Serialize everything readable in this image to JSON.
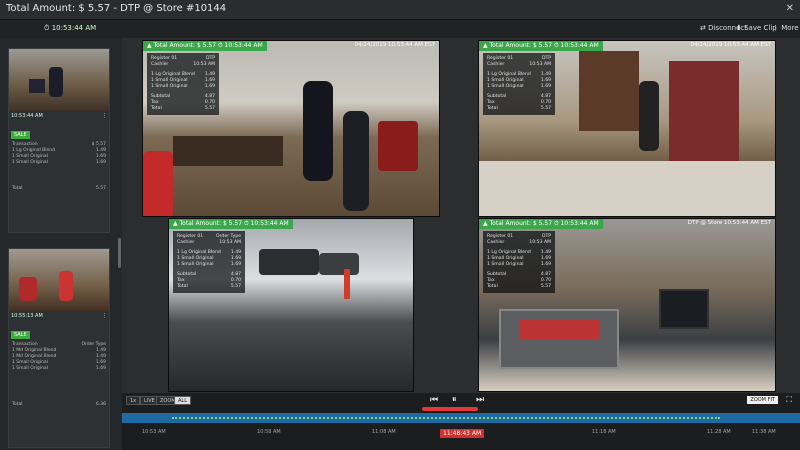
{
  "window": {
    "title": "Total Amount: $ 5.57 - DTP @ Store #10144",
    "close": "✕"
  },
  "toolbar": {
    "time": "10:53:44 AM",
    "disconnect": "Disconnect",
    "save_clip": "Save Clip",
    "more": "More"
  },
  "sidebar": {
    "cards": [
      {
        "cam": "10:53:44 AM",
        "status": "SALE",
        "lines": [
          {
            "l": "Transaction",
            "r": "$ 5.57"
          },
          {
            "l": "1 Lg Original Blend",
            "r": "1.49"
          },
          {
            "l": "1 Small Original",
            "r": "1.69"
          },
          {
            "l": "1 Small Original",
            "r": "1.69"
          },
          {
            "l": "Total",
            "r": "5.57"
          }
        ]
      },
      {
        "cam": "10:55:13 AM",
        "status": "SALE",
        "lines": [
          {
            "l": "Transaction",
            "r": "Order Type"
          },
          {
            "l": "1 Md Original Blend",
            "r": "1.49"
          },
          {
            "l": "1 Md Original Blend",
            "r": "1.49"
          },
          {
            "l": "1 Small Original",
            "r": "1.69"
          },
          {
            "l": "1 Small Original",
            "r": "1.69"
          },
          {
            "l": "Total",
            "r": "6.36"
          }
        ]
      }
    ]
  },
  "cameras": [
    {
      "label": "Total Amount: $ 5.57",
      "time": "10:53:44 AM",
      "ts": "04/24/2019 10:53:44 AM EST",
      "lines": [
        {
          "l": "Register 01",
          "r": "DTP"
        },
        {
          "l": "Cashier",
          "r": "10:53 AM"
        },
        {
          "l": "1 Lg Original Blend",
          "r": "1.49"
        },
        {
          "l": "1 Small Original",
          "r": "1.69"
        },
        {
          "l": "1 Small Original",
          "r": "1.69"
        },
        {
          "l": "Subtotal",
          "r": "4.87"
        },
        {
          "l": "Tax",
          "r": "0.70"
        },
        {
          "l": "Total",
          "r": "5.57"
        }
      ]
    },
    {
      "label": "Total Amount: $ 5.57",
      "time": "10:53:44 AM",
      "ts": "04/24/2019 10:53:44 AM EST",
      "lines": [
        {
          "l": "Register 01",
          "r": "DTP"
        },
        {
          "l": "Cashier",
          "r": "10:53 AM"
        },
        {
          "l": "1 Lg Original Blend",
          "r": "1.49"
        },
        {
          "l": "1 Small Original",
          "r": "1.69"
        },
        {
          "l": "1 Small Original",
          "r": "1.69"
        },
        {
          "l": "Subtotal",
          "r": "4.87"
        },
        {
          "l": "Tax",
          "r": "0.70"
        },
        {
          "l": "Total",
          "r": "5.57"
        }
      ]
    },
    {
      "label": "Total Amount: $ 5.57",
      "time": "10:53:44 AM",
      "ts": "",
      "lines": [
        {
          "l": "Register 01",
          "r": "Order Type"
        },
        {
          "l": "Cashier",
          "r": "10:53 AM"
        },
        {
          "l": "1 Lg Original Blend",
          "r": "1.49"
        },
        {
          "l": "1 Small Original",
          "r": "1.69"
        },
        {
          "l": "1 Small Original",
          "r": "1.69"
        },
        {
          "l": "Subtotal",
          "r": "4.87"
        },
        {
          "l": "Tax",
          "r": "0.70"
        },
        {
          "l": "Total",
          "r": "5.57"
        }
      ]
    },
    {
      "label": "Total Amount: $ 5.57",
      "time": "10:53:44 AM",
      "ts": "DTP @ Store 10:53:44 AM EST",
      "lines": [
        {
          "l": "Register 01",
          "r": "DTP"
        },
        {
          "l": "Cashier",
          "r": "10:53 AM"
        },
        {
          "l": "1 Lg Original Blend",
          "r": "1.49"
        },
        {
          "l": "1 Small Original",
          "r": "1.69"
        },
        {
          "l": "1 Small Original",
          "r": "1.69"
        },
        {
          "l": "Subtotal",
          "r": "4.87"
        },
        {
          "l": "Tax",
          "r": "0.70"
        },
        {
          "l": "Total",
          "r": "5.57"
        }
      ]
    }
  ],
  "controls": {
    "btn_1x": "1x",
    "btn_live": "LIVE",
    "btn_zoom": "ZOOM",
    "btn_all": "ALL",
    "prev": "⏮",
    "pause": "⏸",
    "next": "⏭",
    "current_time": "11:48:43 AM",
    "zoom_fit": "ZOOM FIT",
    "expand": "⛶",
    "ticks": [
      "10:53 AM",
      "10:58 AM",
      "11:08 AM",
      "11:18 AM",
      "11:28 AM",
      "11:38 AM"
    ]
  }
}
